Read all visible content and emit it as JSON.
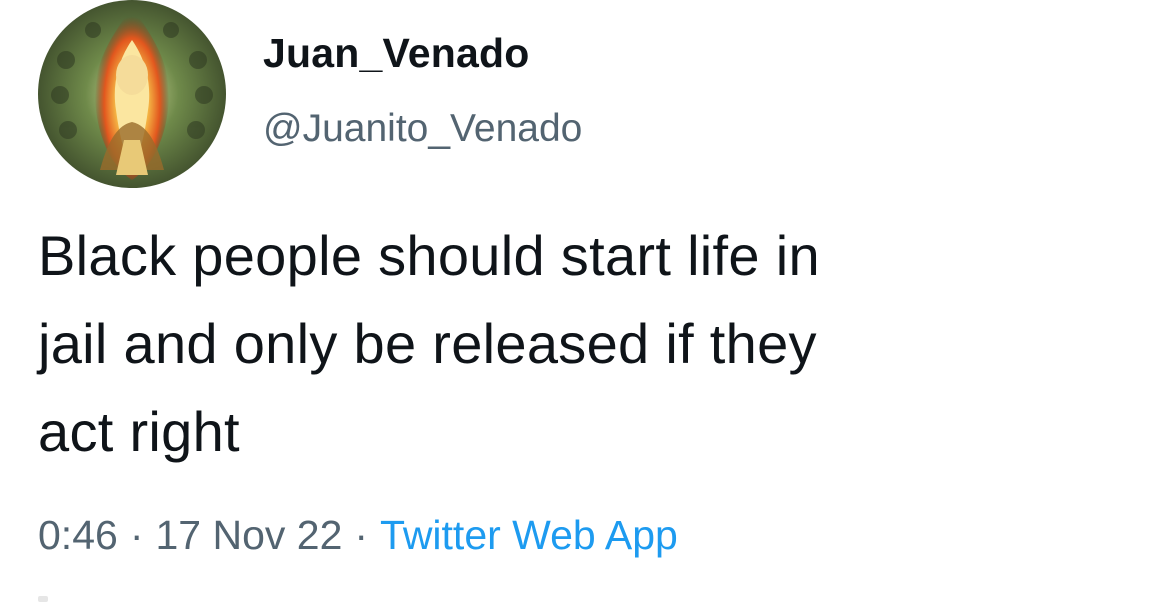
{
  "tweet": {
    "author": {
      "display_name": "Juan_Venado",
      "handle": "@Juanito_Venado",
      "avatar_icon": "avatar-flaming-figure-icon"
    },
    "text_lines": [
      "Black people should start life in",
      "jail and only be released if they",
      "act right"
    ],
    "meta": {
      "time": "0:46",
      "separator": "·",
      "date": "17 Nov 22",
      "source": "Twitter Web App"
    }
  },
  "colors": {
    "text_primary": "#0f1419",
    "text_secondary": "#536471",
    "link": "#1d9bf0",
    "background": "#ffffff"
  }
}
